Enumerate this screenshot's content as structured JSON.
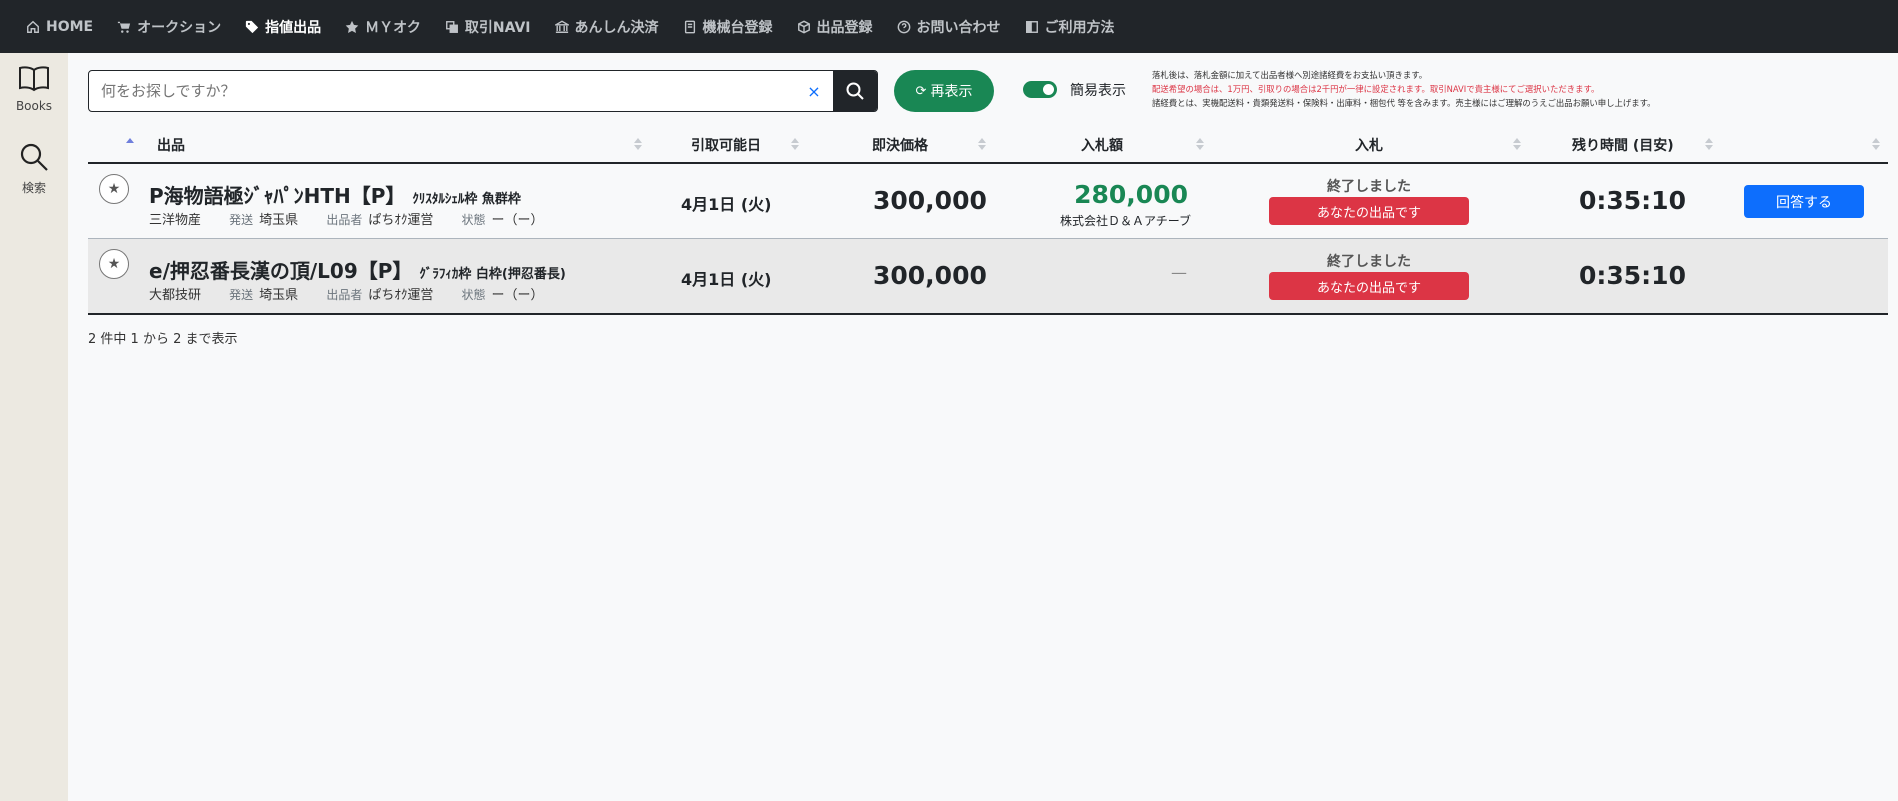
{
  "nav": {
    "items": [
      {
        "label": "HOME",
        "icon": "home-icon"
      },
      {
        "label": "オークション",
        "icon": "cart-icon"
      },
      {
        "label": "指値出品",
        "icon": "tag-icon",
        "active": true
      },
      {
        "label": "ＭＹオク",
        "icon": "star-icon"
      },
      {
        "label": "取引NAVI",
        "icon": "copy-icon"
      },
      {
        "label": "あんしん決済",
        "icon": "bank-icon"
      },
      {
        "label": "機械台登録",
        "icon": "book-icon"
      },
      {
        "label": "出品登録",
        "icon": "box-icon"
      },
      {
        "label": "お問い合わせ",
        "icon": "question-icon"
      },
      {
        "label": "ご利用方法",
        "icon": "manual-icon"
      }
    ]
  },
  "sidebar": {
    "items": [
      {
        "label": "Books",
        "icon": "book-open-icon"
      },
      {
        "label": "検索",
        "icon": "search-icon"
      }
    ]
  },
  "search": {
    "placeholder": "何をお探しですか？",
    "value": "",
    "clear": "×"
  },
  "refresh_label": "再表示",
  "toggle_label": "簡易表示",
  "notes": {
    "line1": "落札後は、落札金額に加えて出品者様へ別途諸経費をお支払い頂きます。",
    "line2": "配送希望の場合は、1万円、引取りの場合は2千円が一律に設定されます。取引NAVIで貴主様にてご選択いただきます。",
    "line3": "諸経費とは、実機配送料・貴類発送料・保険料・出庫料・梱包代 等を含みます。売主様にはご理解のうえご出品お願い申し上げます。"
  },
  "table": {
    "headers": {
      "item": "出品",
      "pickup": "引取可能日",
      "buyout": "即決価格",
      "bid_amount": "入札額",
      "bid": "入札",
      "remaining": "残り時間 (目安)"
    },
    "rows": [
      {
        "title": "P海物語極ｼﾞｬﾊﾟﾝHTH【P】",
        "subtitle": "ｸﾘｽﾀﾙｼｪﾙ枠 魚群枠",
        "maker": "三洋物産",
        "ship_label": "発送",
        "ship": "埼玉県",
        "seller_label": "出品者",
        "seller": "ぱちｵｸ運営",
        "cond_label": "状態",
        "cond": "ー（ー）",
        "pickup_date": "4月1日 (火)",
        "buyout": "300,000",
        "bid": "280,000",
        "bidder": "株式会社Ｄ＆Ａアチーブ",
        "status": "終了しました",
        "badge": "あなたの出品です",
        "remaining": "0:35:10",
        "action": "回答する"
      },
      {
        "title": "e/押忍番長漢の頂/L09【P】",
        "subtitle": "ｸﾞﾗﾌｨｶ枠 白枠(押忍番長)",
        "maker": "大都技研",
        "ship_label": "発送",
        "ship": "埼玉県",
        "seller_label": "出品者",
        "seller": "ぱちｵｸ運営",
        "cond_label": "状態",
        "cond": "ー（ー）",
        "pickup_date": "4月1日 (火)",
        "buyout": "300,000",
        "bid": "—",
        "status": "終了しました",
        "badge": "あなたの出品です",
        "remaining": "0:35:10"
      }
    ]
  },
  "count_text": "2 件中 1 から 2 まで表示",
  "colors": {
    "nav_bg": "#212529",
    "green": "#198754",
    "red": "#dc3545",
    "blue": "#0d6efd",
    "sidebar_bg": "#ece9e1"
  }
}
